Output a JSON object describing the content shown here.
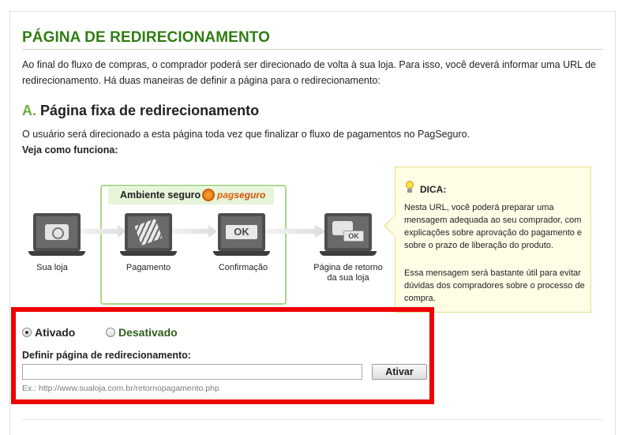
{
  "page": {
    "title": "PÁGINA DE REDIRECIONAMENTO",
    "intro": "Ao final do fluxo de compras, o comprador poderá ser direcionado de volta à sua loja. Para isso, você deverá informar uma URL de redirecionamento. Há duas maneiras de definir a página para o redirecionamento:"
  },
  "section": {
    "letter": "A.",
    "title": "Página fixa de redirecionamento",
    "description": "O usuário será direcionado a esta página toda vez que finalizar o fluxo de pagamentos no PagSeguro.",
    "how_label": "Veja como funciona:"
  },
  "diagram": {
    "secure_label": "Ambiente seguro",
    "logo_text_a": "pag",
    "logo_text_b": "seguro",
    "steps": [
      {
        "label": "Sua loja",
        "icon": "camera-icon"
      },
      {
        "label": "Pagamento",
        "icon": "card-icon"
      },
      {
        "label": "Confirmação",
        "icon": "ok-icon"
      },
      {
        "label_line1": "Página de retorno",
        "label_line2": "da sua loja",
        "icon": "camera-ok-icon",
        "ok_text": "OK"
      }
    ],
    "ok_text": "OK"
  },
  "tip": {
    "title": "DICA:",
    "paragraph1": "Nesta URL, você poderá preparar uma mensagem adequada ao seu comprador, com explicações sobre aprovação do pagamento e sobre o prazo de liberação do produto.",
    "paragraph2": "Essa mensagem será bastante útil para evitar dúvidas dos compradores sobre o processo de compra."
  },
  "form": {
    "radio_on_label": "Ativado",
    "radio_off_label": "Desativado",
    "selected": "Ativado",
    "field_label": "Definir página de redirecionamento:",
    "url_value": "",
    "button_label": "Ativar",
    "example": "Ex.: http://www.sualoja.com.br/retornopagamento.php"
  },
  "colors": {
    "title_green": "#2f7d12",
    "section_letter_green": "#6fae3c",
    "highlight_red": "#ee0000",
    "tip_background": "#fffde6"
  }
}
